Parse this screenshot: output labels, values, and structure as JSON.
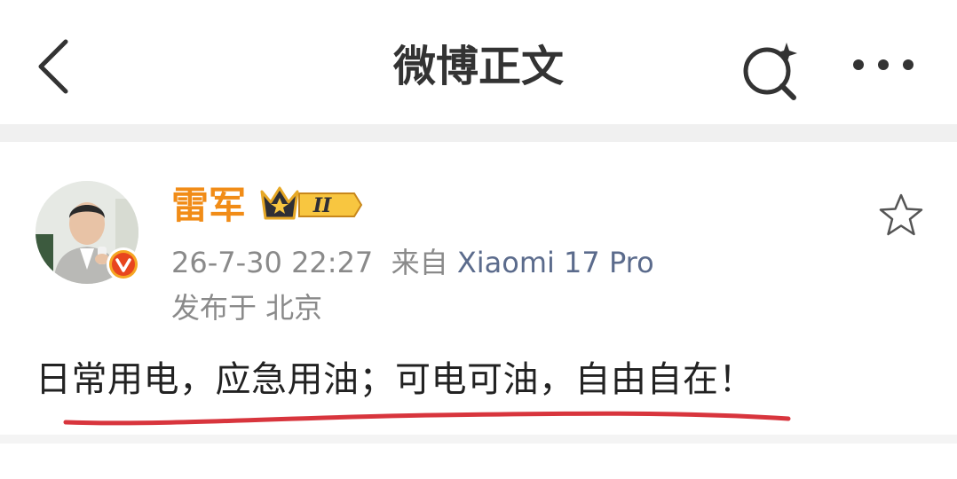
{
  "header": {
    "title": "微博正文",
    "back_icon": "chevron-left-icon",
    "search_icon": "search-sparkle-icon",
    "more_icon": "more-dots-icon"
  },
  "post": {
    "author": {
      "name": "雷军",
      "name_color": "#f18c17",
      "member_level": "II",
      "verified": true
    },
    "timestamp": "26-7-30 22:27",
    "source_prefix": "来自",
    "source_device": "Xiaomi 17 Pro",
    "location": "发布于 北京",
    "content": "日常用电，应急用油；可电可油，自由自在！",
    "favorite_icon": "star-outline-icon"
  },
  "colors": {
    "accent_orange": "#f18c17",
    "source_link": "#5b6b8c",
    "underline_red": "#d8353d",
    "meta_gray": "#8a8a8a"
  }
}
